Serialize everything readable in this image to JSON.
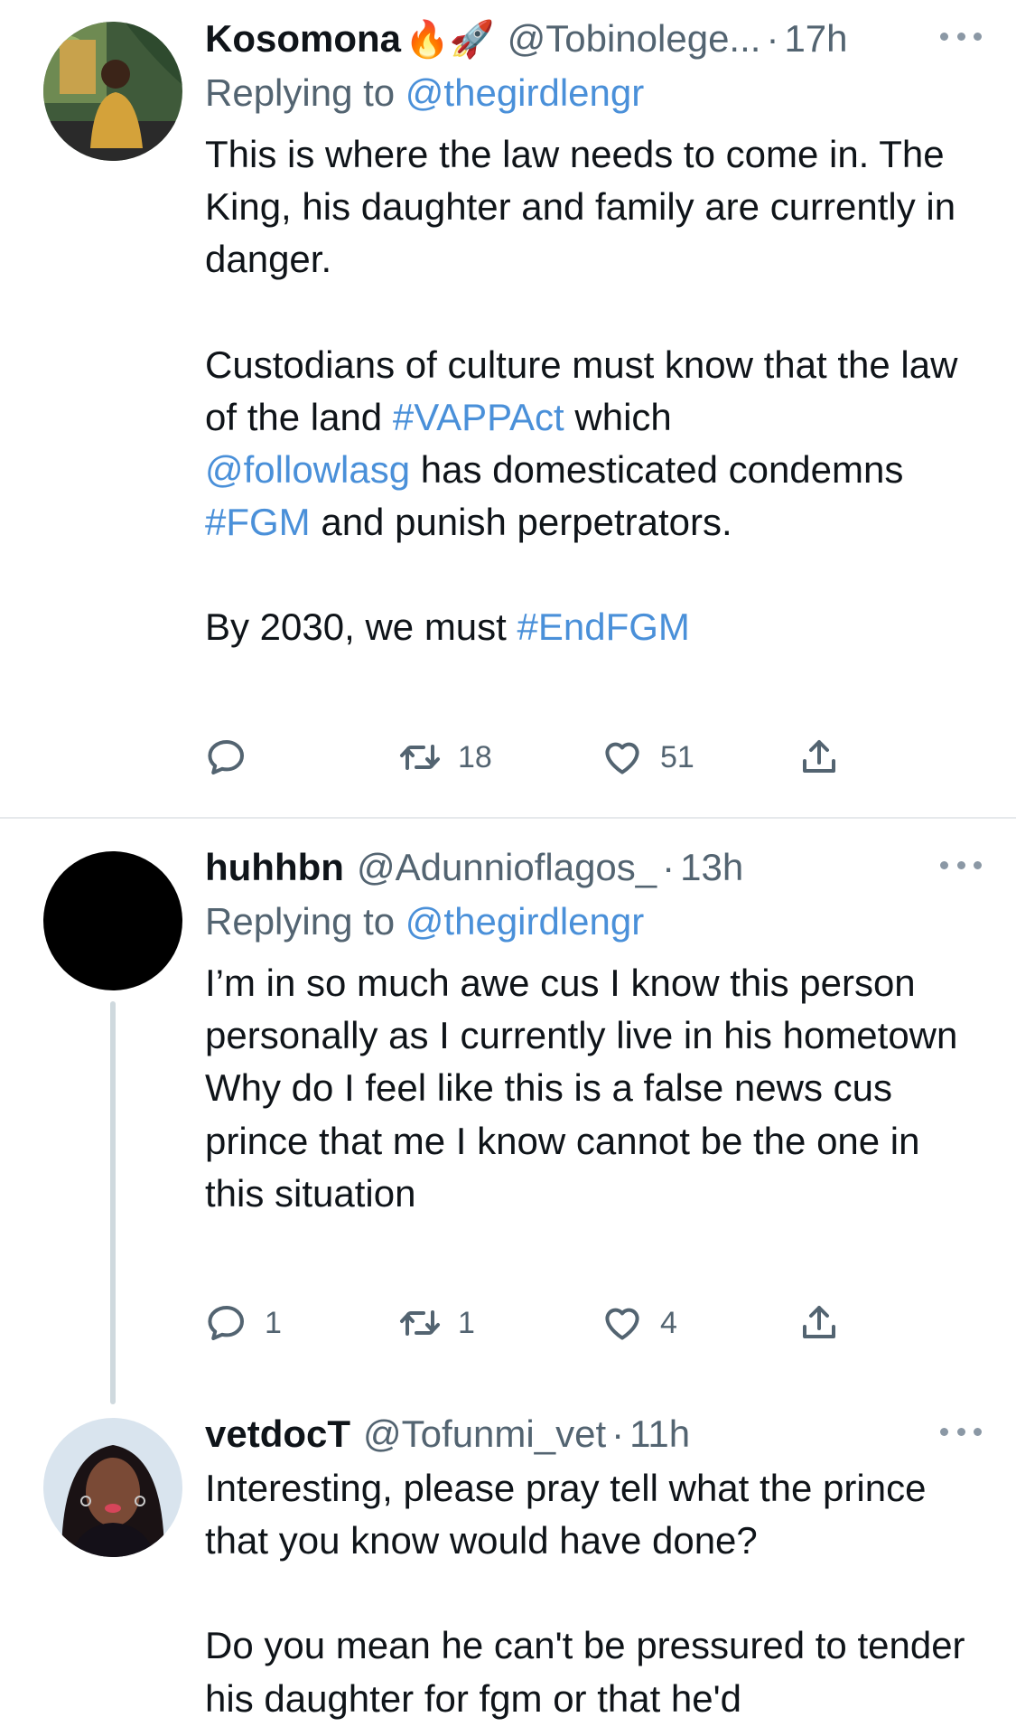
{
  "tweets": [
    {
      "name": "Kosomona",
      "emoji": "🔥🚀",
      "handle": "@Tobinolege...",
      "time": "17h",
      "replying_label": "Replying to",
      "replying_to": "@thegirdlengr",
      "body": {
        "p1": "This is where the law needs to come in. The King, his daughter and family are currently in danger.",
        "p2_a": "Custodians of culture must know that the law of the land",
        "p2_tag1": "#VAPPAct",
        "p2_b": "which",
        "p2_mention": "@followlasg",
        "p2_c": "has domesticated condemns",
        "p2_tag2": "#FGM",
        "p2_d": "and punish perpetrators.",
        "p3_a": "By 2030, we must",
        "p3_tag": "#EndFGM"
      },
      "replies": "",
      "retweets": "18",
      "likes": "51"
    },
    {
      "name": "huhhbn",
      "handle": "@Adunnioflagos_",
      "time": "13h",
      "replying_label": "Replying to",
      "replying_to": "@thegirdlengr",
      "body": {
        "p1": "I’m in so much awe cus I know this person personally as I currently live in his hometown",
        "p2": "Why do I feel like this is a false news cus prince that me I know cannot be the one in this situation"
      },
      "replies": "1",
      "retweets": "1",
      "likes": "4"
    },
    {
      "name": "vetdocT",
      "handle": "@Tofunmi_vet",
      "time": "11h",
      "body": {
        "p1": "Interesting, please pray tell what the prince that you know would have done?",
        "p2": "Do you mean he can't be pressured to tender his daughter for fgm or that he'd"
      }
    }
  ],
  "icons": {
    "reply": "reply-icon",
    "retweet": "retweet-icon",
    "like": "heart-icon",
    "share": "share-icon",
    "more": "more-icon"
  },
  "colors": {
    "link": "#4a90d9",
    "muted": "#536471",
    "text": "#0f1419"
  }
}
